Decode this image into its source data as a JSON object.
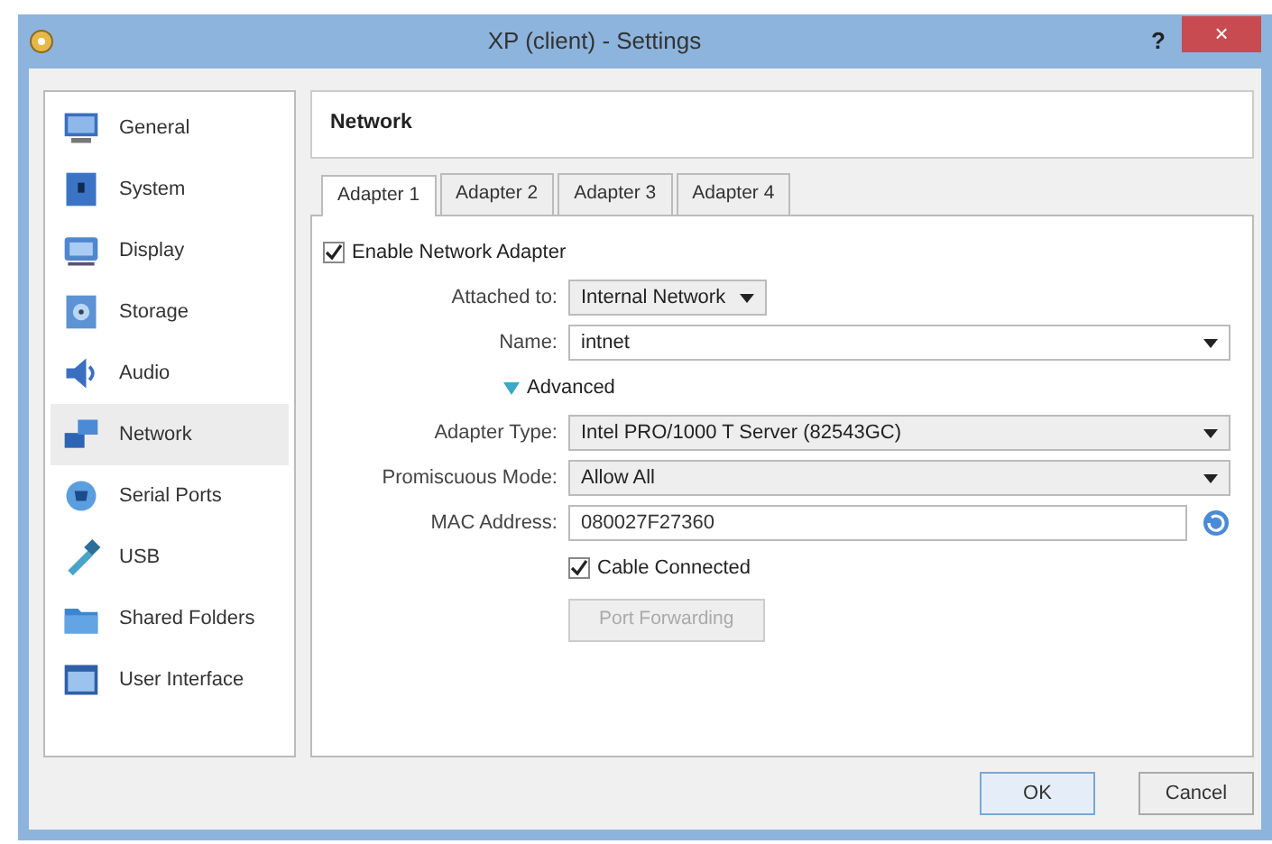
{
  "window": {
    "title": "XP (client) - Settings",
    "help": "?",
    "close": "×"
  },
  "sidebar": {
    "items": [
      {
        "label": "General",
        "kind": "general",
        "selected": false
      },
      {
        "label": "System",
        "kind": "system",
        "selected": false
      },
      {
        "label": "Display",
        "kind": "display",
        "selected": false
      },
      {
        "label": "Storage",
        "kind": "storage",
        "selected": false
      },
      {
        "label": "Audio",
        "kind": "audio",
        "selected": false
      },
      {
        "label": "Network",
        "kind": "network",
        "selected": true
      },
      {
        "label": "Serial Ports",
        "kind": "serial",
        "selected": false
      },
      {
        "label": "USB",
        "kind": "usb",
        "selected": false
      },
      {
        "label": "Shared Folders",
        "kind": "folder",
        "selected": false
      },
      {
        "label": "User Interface",
        "kind": "ui",
        "selected": false
      }
    ]
  },
  "section_title": "Network",
  "tabs": [
    {
      "label": "Adapter 1",
      "selected": true
    },
    {
      "label": "Adapter 2",
      "selected": false
    },
    {
      "label": "Adapter 3",
      "selected": false
    },
    {
      "label": "Adapter 4",
      "selected": false
    }
  ],
  "form": {
    "enable_adapter": {
      "label": "Enable Network Adapter",
      "checked": true
    },
    "attached_to": {
      "label": "Attached to:",
      "value": "Internal Network"
    },
    "name": {
      "label": "Name:",
      "value": "intnet"
    },
    "advanced": {
      "label": "Advanced",
      "expanded": true
    },
    "adapter_type": {
      "label": "Adapter Type:",
      "value": "Intel PRO/1000 T Server (82543GC)"
    },
    "promiscuous_mode": {
      "label": "Promiscuous Mode:",
      "value": "Allow All"
    },
    "mac_address": {
      "label": "MAC Address:",
      "value": "080027F27360"
    },
    "cable_connected": {
      "label": "Cable Connected",
      "checked": true
    },
    "port_forwarding": {
      "label": "Port Forwarding",
      "disabled": true
    }
  },
  "buttons": [
    "OK",
    "Cancel"
  ]
}
